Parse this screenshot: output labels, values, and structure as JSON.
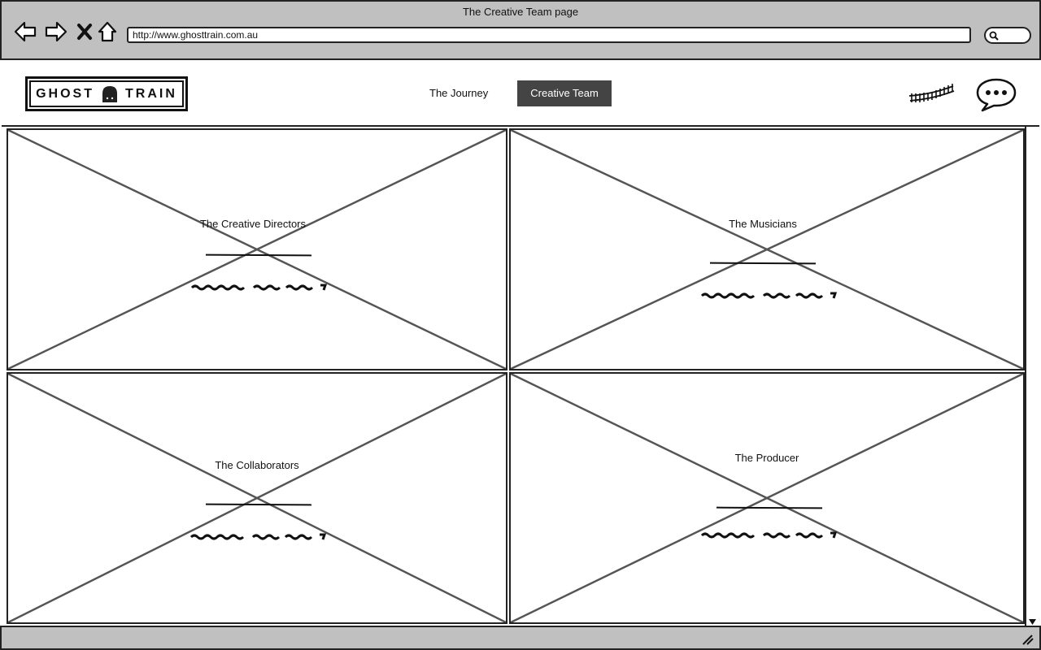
{
  "window": {
    "title": "The Creative Team page",
    "url": "http://www.ghosttrain.com.au"
  },
  "toolbar": {
    "back_icon": "back-arrow-icon",
    "forward_icon": "forward-arrow-icon",
    "stop_icon": "close-icon",
    "home_icon": "home-icon",
    "search_icon": "search-icon"
  },
  "header": {
    "logo": {
      "left_text": "GHOST",
      "right_text": "TRAIN",
      "icon": "ghost-icon"
    },
    "nav": [
      {
        "label": "The Journey",
        "active": false
      },
      {
        "label": "Creative Team",
        "active": true
      }
    ],
    "track_icon": "train-track-icon",
    "chat_icon": "speech-bubble-icon"
  },
  "cards": [
    {
      "title": "The Creative Directors"
    },
    {
      "title": "The Musicians"
    },
    {
      "title": "The Collaborators"
    },
    {
      "title": "The Producer"
    }
  ],
  "colors": {
    "chrome": "#c0c0c0",
    "active_nav": "#444444",
    "placeholder_lines": "#555555"
  }
}
